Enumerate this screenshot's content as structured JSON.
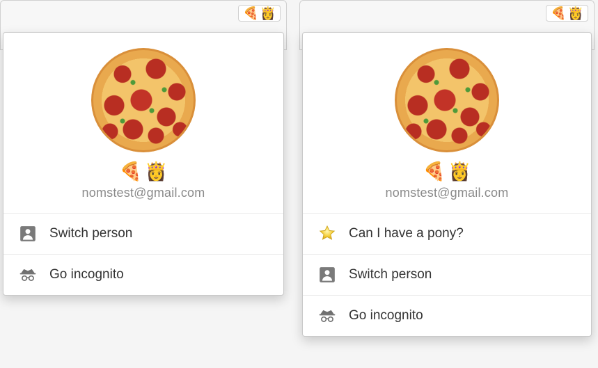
{
  "profile": {
    "name_emoji": [
      "🍕",
      "👸"
    ],
    "email": "nomstest@gmail.com"
  },
  "avatar_button": {
    "emoji": [
      "🍕",
      "👸"
    ]
  },
  "menus": {
    "left": {
      "items": [
        {
          "icon": "person-icon",
          "label": "Switch person"
        },
        {
          "icon": "incognito-icon",
          "label": "Go incognito"
        }
      ]
    },
    "right": {
      "items": [
        {
          "icon": "star-icon",
          "label": "Can I have a pony?"
        },
        {
          "icon": "person-icon",
          "label": "Switch person"
        },
        {
          "icon": "incognito-icon",
          "label": "Go incognito"
        }
      ]
    }
  }
}
